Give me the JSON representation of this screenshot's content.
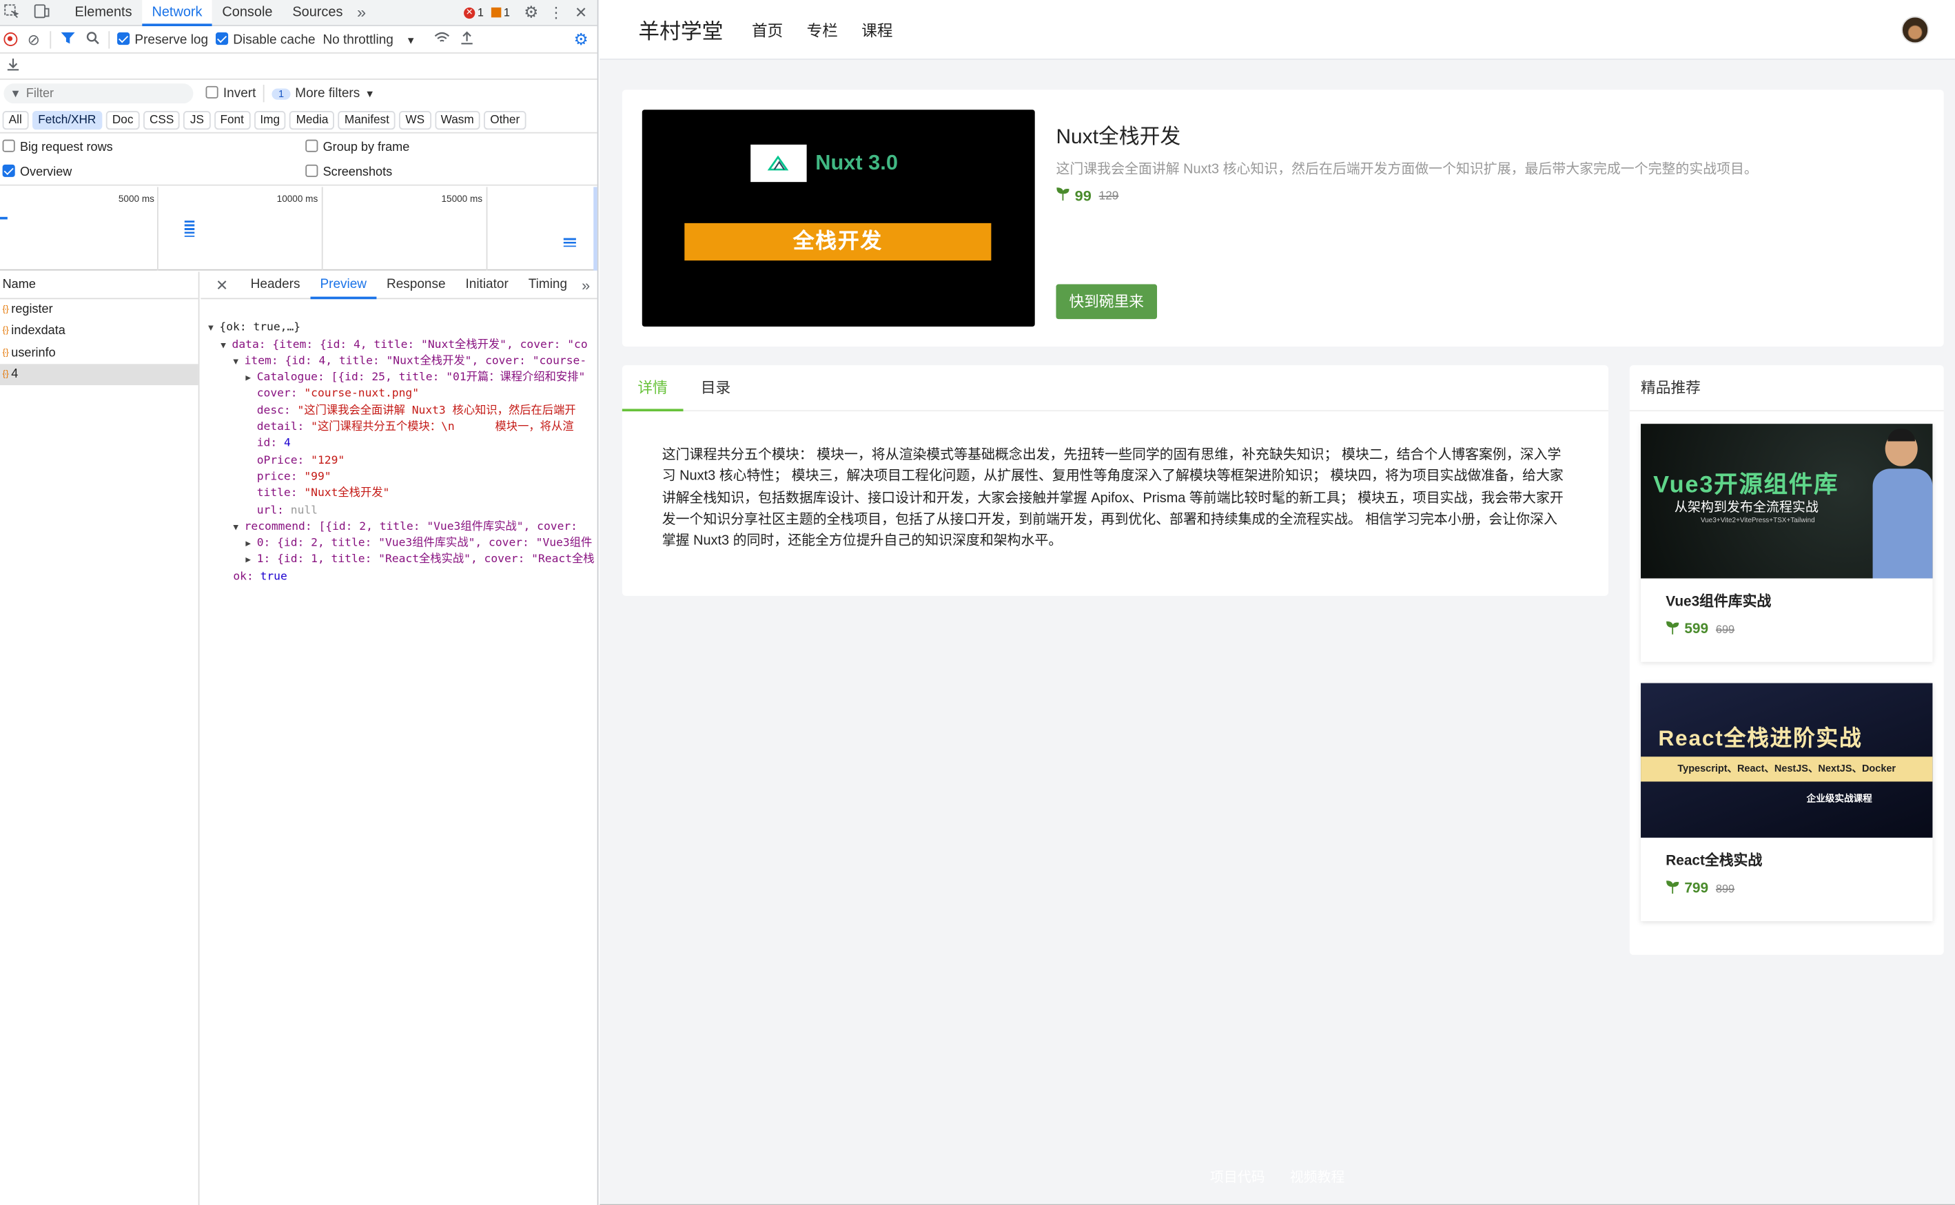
{
  "devtools": {
    "tabs": [
      "Elements",
      "Network",
      "Console",
      "Sources"
    ],
    "active_tab": "Network",
    "error_count": "1",
    "warning_count": "1",
    "toolbar": {
      "preserve_log": "Preserve log",
      "disable_cache": "Disable cache",
      "throttling": "No throttling"
    },
    "filter": {
      "placeholder": "Filter",
      "invert": "Invert",
      "more_filters_count": "1",
      "more_filters": "More filters"
    },
    "type_filters": [
      "All",
      "Fetch/XHR",
      "Doc",
      "CSS",
      "JS",
      "Font",
      "Img",
      "Media",
      "Manifest",
      "WS",
      "Wasm",
      "Other"
    ],
    "active_type_filter": "Fetch/XHR",
    "options": {
      "big_request_rows": "Big request rows",
      "group_by_frame": "Group by frame",
      "overview": "Overview",
      "screenshots": "Screenshots"
    },
    "timeline_ticks": [
      "5000 ms",
      "10000 ms",
      "15000 ms"
    ],
    "name_header": "Name",
    "requests": [
      "register",
      "indexdata",
      "userinfo",
      "4"
    ],
    "selected_request": "4",
    "detail_tabs": [
      "Headers",
      "Preview",
      "Response",
      "Initiator",
      "Timing"
    ],
    "active_detail_tab": "Preview",
    "preview": {
      "root": "{ok: true,…}",
      "data_line": "data: {item: {id: 4, title: \"Nuxt全栈开发\", cover: \"co",
      "item_line": "item: {id: 4, title: \"Nuxt全栈开发\", cover: \"course-",
      "catalogue_line": "Catalogue: [{id: 25, title: \"01开篇：课程介绍和安排\"",
      "cover_key": "cover:",
      "cover_val": "\"course-nuxt.png\"",
      "desc_key": "desc:",
      "desc_val": "\"这门课我会全面讲解 Nuxt3 核心知识，然后在后端开",
      "detail_key": "detail:",
      "detail_val": "\"这门课程共分五个模块：\\n      模块一，将从渲",
      "id_key": "id:",
      "id_val": "4",
      "oprice_key": "oPrice:",
      "oprice_val": "\"129\"",
      "price_key": "price:",
      "price_val": "\"99\"",
      "title_key": "title:",
      "title_val": "\"Nuxt全栈开发\"",
      "url_key": "url:",
      "url_val": "null",
      "recommend_line": "recommend: [{id: 2, title: \"Vue3组件库实战\", cover: ",
      "rec0_line": "0: {id: 2, title: \"Vue3组件库实战\", cover: \"Vue3组件",
      "rec1_line": "1: {id: 1, title: \"React全栈实战\", cover: \"React全栈",
      "ok_key": "ok:",
      "ok_val": "true"
    }
  },
  "site": {
    "brand": "羊村学堂",
    "nav": [
      "首页",
      "专栏",
      "课程"
    ],
    "course": {
      "cover_logo_text": "Nuxt 3.0",
      "cover_banner": "全栈开发",
      "title": "Nuxt全栈开发",
      "desc": "这门课我会全面讲解 Nuxt3 核心知识，然后在后端开发方面做一个知识扩展，最后带大家完成一个完整的实战项目。",
      "price": "99",
      "old_price": "129",
      "cta": "快到碗里来"
    },
    "tabs": [
      "详情",
      "目录"
    ],
    "active_tab": "详情",
    "detail": "这门课程共分五个模块： 模块一，将从渲染模式等基础概念出发，先扭转一些同学的固有思维，补充缺失知识； 模块二，结合个人博客案例，深入学习 Nuxt3 核心特性； 模块三，解决项目工程化问题，从扩展性、复用性等角度深入了解模块等框架进阶知识； 模块四，将为项目实战做准备，给大家讲解全栈知识，包括数据库设计、接口设计和开发，大家会接触并掌握 Apifox、Prisma 等前端比较时髦的新工具； 模块五，项目实战，我会带大家开发一个知识分享社区主题的全栈项目，包括了从接口开发，到前端开发，再到优化、部署和持续集成的全流程实战。 相信学习完本小册，会让你深入掌握 Nuxt3 的同时，还能全方位提升自己的知识深度和架构水平。",
    "recommend": {
      "title": "精品推荐",
      "items": [
        {
          "cover_title": "Vue3开源组件库",
          "cover_sub": "从架构到发布全流程实战",
          "cover_tags": "Vue3+Vite2+VitePress+TSX+Tailwind",
          "title": "Vue3组件库实战",
          "price": "599",
          "old_price": "699"
        },
        {
          "cover_title": "React全栈进阶实战",
          "cover_sub": "Typescript、React、NestJS、NextJS、Docker",
          "cover_tags": "企业级实战课程",
          "title": "React全栈实战",
          "price": "799",
          "old_price": "899"
        }
      ]
    },
    "footer": [
      "项目代码",
      "视频教程"
    ]
  },
  "colors": {
    "accent": "#1a73e8",
    "brand_green": "#4a8b2c",
    "cta_green": "#5a9e4a",
    "nuxt_orange": "#f09a0a"
  }
}
